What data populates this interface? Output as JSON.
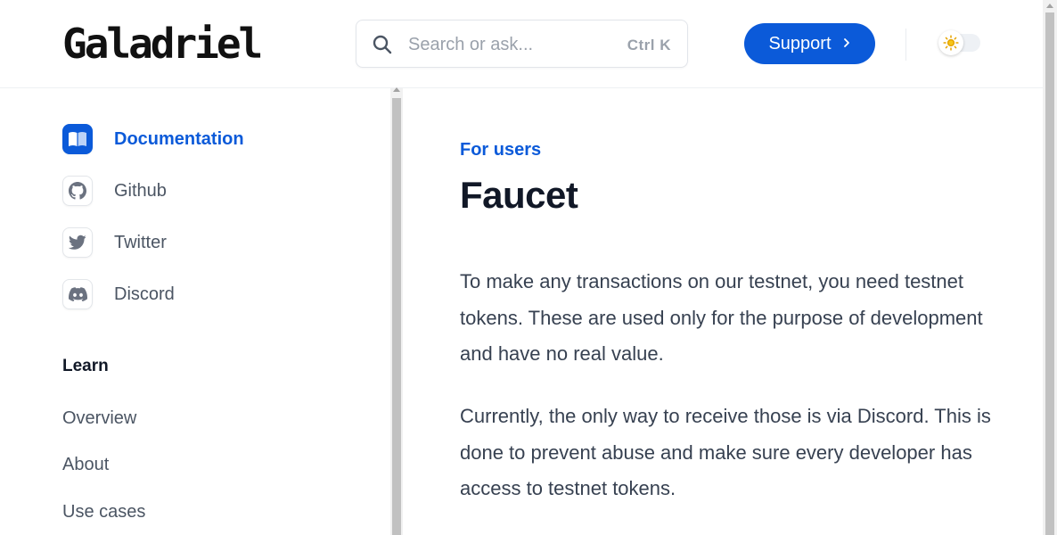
{
  "header": {
    "logo_text": "Galadriel",
    "search": {
      "placeholder": "Search or ask...",
      "shortcut": "Ctrl K"
    },
    "support_label": "Support",
    "theme_toggle": {
      "state": "light"
    }
  },
  "sidebar": {
    "links": [
      {
        "label": "Documentation",
        "icon": "book-icon",
        "active": true
      },
      {
        "label": "Github",
        "icon": "github-icon",
        "active": false
      },
      {
        "label": "Twitter",
        "icon": "twitter-icon",
        "active": false
      },
      {
        "label": "Discord",
        "icon": "discord-icon",
        "active": false
      }
    ],
    "section_title": "Learn",
    "items": [
      "Overview",
      "About",
      "Use cases"
    ]
  },
  "main": {
    "eyebrow": "For users",
    "title": "Faucet",
    "paragraphs": [
      "To make any transactions on our testnet, you need testnet tokens. These are used only for the purpose of development and have no real value.",
      "Currently, the only way to receive those is via Discord. This is done to prevent abuse and make sure every developer has access to testnet tokens."
    ]
  },
  "colors": {
    "accent": "#0b5ad9",
    "text": "#374151",
    "heading": "#111827"
  }
}
